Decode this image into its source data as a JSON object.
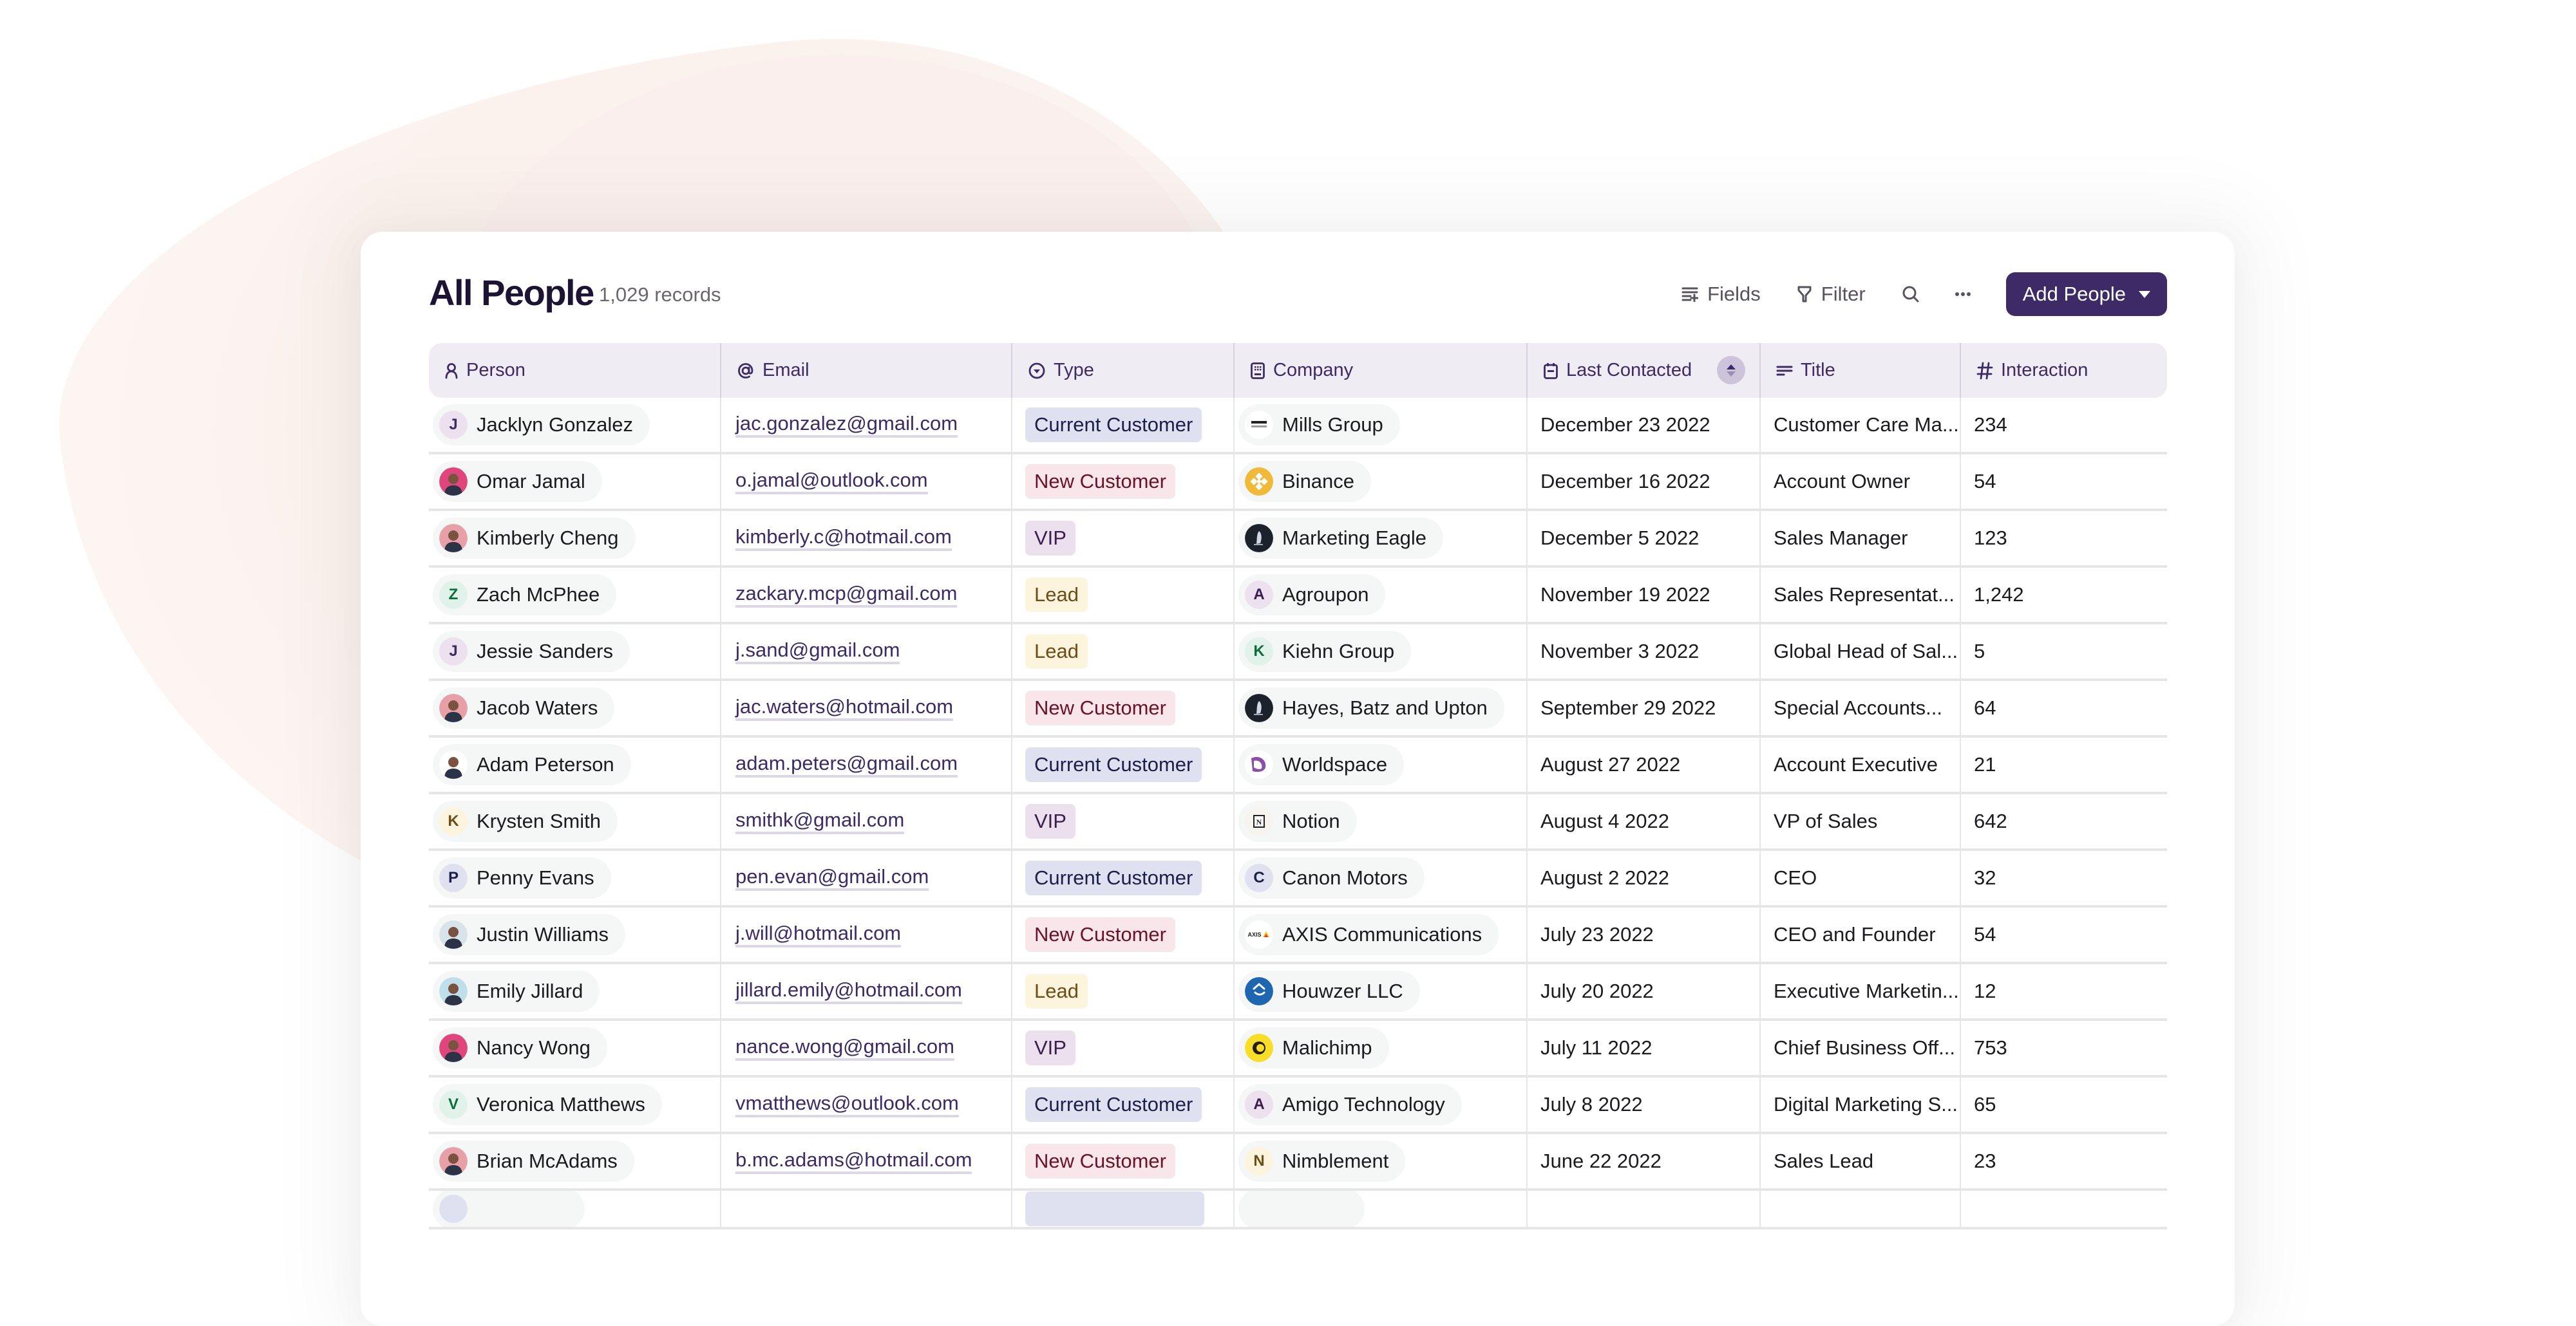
{
  "header": {
    "title": "All People",
    "record_count": "1,029 records"
  },
  "toolbar": {
    "fields_label": "Fields",
    "filter_label": "Filter",
    "add_label": "Add People"
  },
  "columns": [
    {
      "label": "Person",
      "icon": "person-icon"
    },
    {
      "label": "Email",
      "icon": "at-icon"
    },
    {
      "label": "Type",
      "icon": "dropdown-circle-icon"
    },
    {
      "label": "Company",
      "icon": "building-icon"
    },
    {
      "label": "Last Contacted",
      "icon": "calendar-icon",
      "sorted": true
    },
    {
      "label": "Title",
      "icon": "text-lines-icon"
    },
    {
      "label": "Interaction",
      "icon": "hash-icon"
    }
  ],
  "type_colors": {
    "Current Customer": {
      "bg": "#dfe1f0",
      "fg": "#1c1e4a"
    },
    "New Customer": {
      "bg": "#f8e6ea",
      "fg": "#6b1228"
    },
    "VIP": {
      "bg": "#ece0ee",
      "fg": "#3a1e4e"
    },
    "Lead": {
      "bg": "#fdf4dd",
      "fg": "#6e4c17"
    }
  },
  "accent_color": "#3d2a66",
  "rows": [
    {
      "person": "Jacklyn Gonzalez",
      "avatar": {
        "kind": "initial",
        "text": "J",
        "bg": "#ede0ef",
        "fg": "#3d2a66"
      },
      "email": "jac.gonzalez@gmail.com",
      "type": "Current Customer",
      "company": "Mills Group",
      "logo": {
        "kind": "mills"
      },
      "last_contacted": "December 23 2022",
      "title": "Customer Care Ma...",
      "interaction": "234"
    },
    {
      "person": "Omar Jamal",
      "avatar": {
        "kind": "photo",
        "bg": "#e0457b"
      },
      "email": "o.jamal@outlook.com",
      "type": "New Customer",
      "company": "Binance",
      "logo": {
        "kind": "binance"
      },
      "last_contacted": "December 16 2022",
      "title": "Account Owner",
      "interaction": "54"
    },
    {
      "person": "Kimberly Cheng",
      "avatar": {
        "kind": "photo",
        "bg": "#e8a0a8"
      },
      "email": "kimberly.c@hotmail.com",
      "type": "VIP",
      "company": "Marketing Eagle",
      "logo": {
        "kind": "eagle"
      },
      "last_contacted": "December 5 2022",
      "title": "Sales Manager",
      "interaction": "123"
    },
    {
      "person": "Zach McPhee",
      "avatar": {
        "kind": "initial",
        "text": "Z",
        "bg": "#e1f2ea",
        "fg": "#0f6b3f"
      },
      "email": "zackary.mcp@gmail.com",
      "type": "Lead",
      "company": "Agroupon",
      "logo": {
        "kind": "initial",
        "text": "A",
        "bg": "#ede0ef",
        "fg": "#3a1e4e"
      },
      "last_contacted": "November 19 2022",
      "title": "Sales Representat...",
      "interaction": "1,242"
    },
    {
      "person": "Jessie Sanders",
      "avatar": {
        "kind": "initial",
        "text": "J",
        "bg": "#ede0ef",
        "fg": "#3d2a66"
      },
      "email": "j.sand@gmail.com",
      "type": "Lead",
      "company": "Kiehn Group",
      "logo": {
        "kind": "initial",
        "text": "K",
        "bg": "#e1f2ea",
        "fg": "#0f6b3f"
      },
      "last_contacted": "November 3 2022",
      "title": "Global Head of Sal...",
      "interaction": "5"
    },
    {
      "person": "Jacob Waters",
      "avatar": {
        "kind": "photo",
        "bg": "#e8a0a8"
      },
      "email": "jac.waters@hotmail.com",
      "type": "New Customer",
      "company": "Hayes, Batz and Upton",
      "logo": {
        "kind": "eagle"
      },
      "last_contacted": "September 29 2022",
      "title": "Special Accounts...",
      "interaction": "64"
    },
    {
      "person": "Adam Peterson",
      "avatar": {
        "kind": "photo",
        "bg": "#ffffff"
      },
      "email": "adam.peters@gmail.com",
      "type": "Current Customer",
      "company": "Worldspace",
      "logo": {
        "kind": "worldspace"
      },
      "last_contacted": "August 27 2022",
      "title": "Account Executive",
      "interaction": "21"
    },
    {
      "person": "Krysten Smith",
      "avatar": {
        "kind": "initial",
        "text": "K",
        "bg": "#fdf4dd",
        "fg": "#6e4c17"
      },
      "email": "smithk@gmail.com",
      "type": "VIP",
      "company": "Notion",
      "logo": {
        "kind": "notion"
      },
      "last_contacted": "August 4 2022",
      "title": "VP of Sales",
      "interaction": "642"
    },
    {
      "person": "Penny Evans",
      "avatar": {
        "kind": "initial",
        "text": "P",
        "bg": "#dfe1f0",
        "fg": "#1c1e4a"
      },
      "email": "pen.evan@gmail.com",
      "type": "Current Customer",
      "company": "Canon Motors",
      "logo": {
        "kind": "initial",
        "text": "C",
        "bg": "#dfe1f0",
        "fg": "#1c1e4a"
      },
      "last_contacted": "August 2 2022",
      "title": "CEO",
      "interaction": "32"
    },
    {
      "person": "Justin Williams",
      "avatar": {
        "kind": "photo",
        "bg": "#d9e3ea"
      },
      "email": "j.will@hotmail.com",
      "type": "New Customer",
      "company": "AXIS Communications",
      "logo": {
        "kind": "axis"
      },
      "last_contacted": "July 23 2022",
      "title": "CEO and Founder",
      "interaction": "54"
    },
    {
      "person": "Emily Jillard",
      "avatar": {
        "kind": "photo",
        "bg": "#bfe0ea"
      },
      "email": "jillard.emily@hotmail.com",
      "type": "Lead",
      "company": "Houwzer LLC",
      "logo": {
        "kind": "houwzer"
      },
      "last_contacted": "July 20 2022",
      "title": "Executive Marketin...",
      "interaction": "12"
    },
    {
      "person": "Nancy Wong",
      "avatar": {
        "kind": "photo",
        "bg": "#e0457b"
      },
      "email": "nance.wong@gmail.com",
      "type": "VIP",
      "company": "Malichimp",
      "logo": {
        "kind": "mailchimp"
      },
      "last_contacted": "July 11 2022",
      "title": "Chief Business Off...",
      "interaction": "753"
    },
    {
      "person": "Veronica Matthews",
      "avatar": {
        "kind": "initial",
        "text": "V",
        "bg": "#e1f2ea",
        "fg": "#0f6b3f"
      },
      "email": "vmatthews@outlook.com",
      "type": "Current Customer",
      "company": "Amigo Technology",
      "logo": {
        "kind": "initial",
        "text": "A",
        "bg": "#ede0ef",
        "fg": "#3a1e4e"
      },
      "last_contacted": "July 8 2022",
      "title": "Digital Marketing S...",
      "interaction": "65"
    },
    {
      "person": "Brian McAdams",
      "avatar": {
        "kind": "photo",
        "bg": "#e8a0a8"
      },
      "email": "b.mc.adams@hotmail.com",
      "type": "New Customer",
      "company": "Nimblement",
      "logo": {
        "kind": "initial",
        "text": "N",
        "bg": "#fdf4dd",
        "fg": "#6e4c17"
      },
      "last_contacted": "June 22 2022",
      "title": "Sales Lead",
      "interaction": "23"
    }
  ]
}
